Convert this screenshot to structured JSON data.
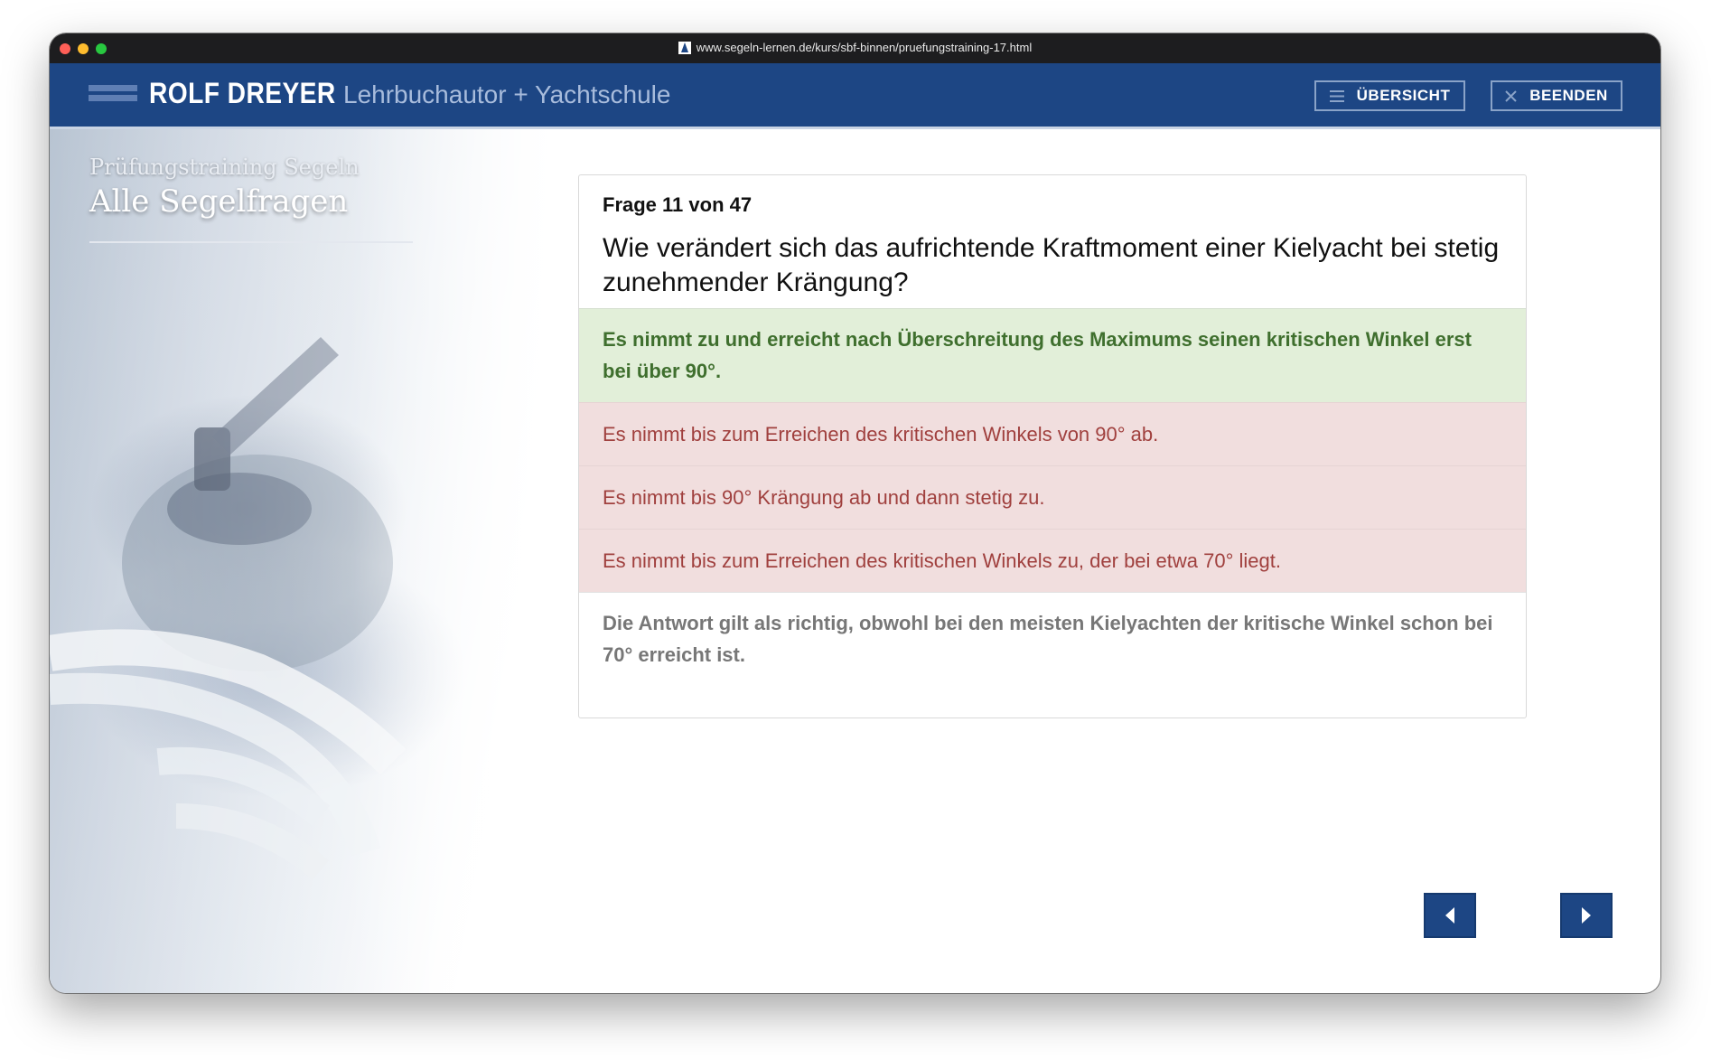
{
  "browser": {
    "url": "www.segeln-lernen.de/kurs/sbf-binnen/pruefungstraining-17.html"
  },
  "header": {
    "brand": "ROLF DREYER",
    "tagline": "Lehrbuchautor + Yachtschule",
    "overview_label": "ÜBERSICHT",
    "quit_label": "BEENDEN"
  },
  "sidebar": {
    "kicker": "Prüfungstraining Segeln",
    "title": "Alle Segelfragen"
  },
  "quiz": {
    "counter": "Frage 11 von 47",
    "question": "Wie verändert sich das aufrichtende Kraftmoment einer Kielyacht bei stetig zunehmender Krängung?",
    "answers": [
      {
        "text": "Es nimmt zu und erreicht nach Überschreitung des Maximums seinen kritischen Winkel erst bei über 90°.",
        "status": "correct"
      },
      {
        "text": "Es nimmt bis zum Erreichen des kritischen Winkels von 90° ab.",
        "status": "wrong"
      },
      {
        "text": "Es nimmt bis 90° Krängung ab und dann stetig zu.",
        "status": "wrong"
      },
      {
        "text": "Es nimmt bis zum Erreichen des kritischen Winkels zu, der bei etwa 70° liegt.",
        "status": "wrong"
      }
    ],
    "note": "Die Antwort gilt als richtig, obwohl bei den meisten Kielyachten der kritische Winkel schon bei 70° erreicht ist."
  },
  "navigation": {
    "prev_icon": "triangle-left-icon",
    "next_icon": "triangle-right-icon"
  },
  "colors": {
    "header_bg": "#1d4684",
    "correct_bg": "#e2efd9",
    "correct_text": "#3f6f2e",
    "wrong_bg": "#f1dede",
    "wrong_text": "#a0403e"
  }
}
